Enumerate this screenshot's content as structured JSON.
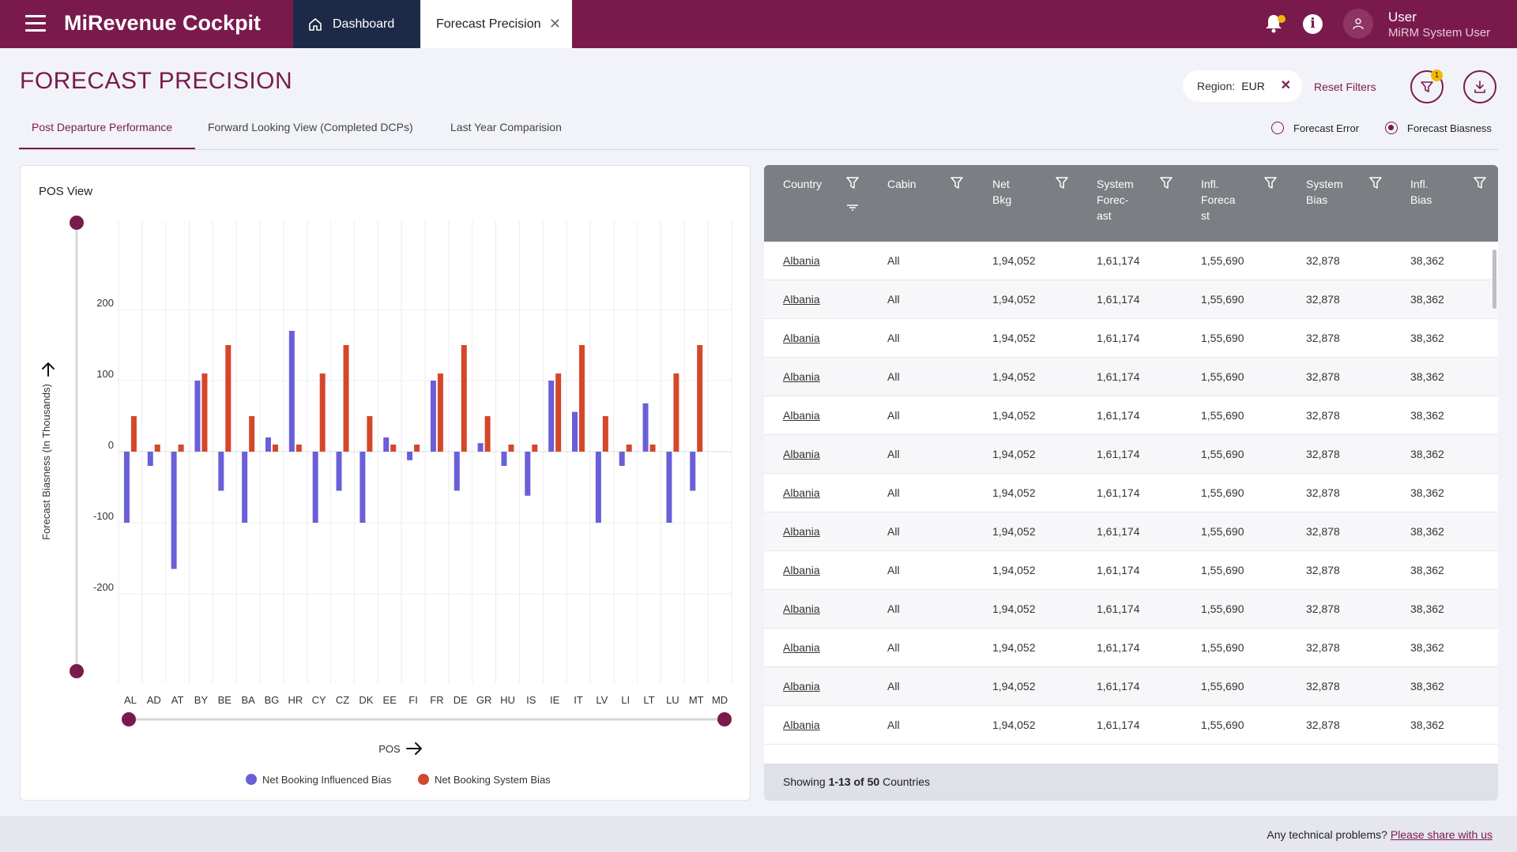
{
  "app": {
    "title": "MiRevenue Cockpit"
  },
  "nav": {
    "dashboard_label": "Dashboard",
    "active_tab_label": "Forecast Precision"
  },
  "user": {
    "name": "User",
    "role": "MiRM System User"
  },
  "page": {
    "title": "FORECAST PRECISION"
  },
  "filters": {
    "region_label": "Region:",
    "region_value": "EUR",
    "reset_label": "Reset Filters",
    "filter_count": "1"
  },
  "subtabs": [
    {
      "label": "Post Departure Performance",
      "active": true
    },
    {
      "label": "Forward Looking View (Completed DCPs)",
      "active": false
    },
    {
      "label": "Last Year Comparision",
      "active": false
    }
  ],
  "view_mode": {
    "options": [
      "Forecast Error",
      "Forecast Biasness"
    ],
    "selected": "Forecast Biasness"
  },
  "chart_title": "POS View",
  "chart_data": {
    "type": "bar",
    "title": "",
    "xlabel": "POS",
    "ylabel": "Forecast Biasness (In Thousands)",
    "ylim": [
      -300,
      300
    ],
    "yticks": [
      200,
      100,
      0,
      -100,
      -200
    ],
    "grid": true,
    "legend_position": "bottom",
    "categories": [
      "AL",
      "AD",
      "AT",
      "BY",
      "BE",
      "BA",
      "BG",
      "HR",
      "CY",
      "CZ",
      "DK",
      "EE",
      "FI",
      "FR",
      "DE",
      "GR",
      "HU",
      "IS",
      "IE",
      "IT",
      "LV",
      "LI",
      "LT",
      "LU",
      "MT",
      "MD"
    ],
    "series": [
      {
        "name": "Net Booking Influenced Bias",
        "color": "#6a5fd8",
        "values": [
          -100,
          -20,
          -165,
          100,
          -55,
          -100,
          20,
          170,
          -100,
          -55,
          -100,
          20,
          -12,
          100,
          -55,
          12,
          -20,
          -62,
          100,
          56,
          -100,
          -20,
          68,
          -100,
          -55,
          0
        ]
      },
      {
        "name": "Net Booking System Bias",
        "color": "#d4472a",
        "values": [
          50,
          10,
          10,
          110,
          150,
          50,
          10,
          10,
          110,
          150,
          50,
          10,
          10,
          110,
          150,
          50,
          10,
          10,
          110,
          150,
          50,
          10,
          10,
          110,
          150,
          0
        ]
      }
    ]
  },
  "table": {
    "columns": [
      {
        "label": "Country"
      },
      {
        "label": "Cabin"
      },
      {
        "label": "Net Bkg"
      },
      {
        "label": "System Forec-ast"
      },
      {
        "label": "Infl. Foreca st"
      },
      {
        "label": "System Bias"
      },
      {
        "label": "Infl. Bias"
      }
    ],
    "column_lines": [
      [
        "Country"
      ],
      [
        "Cabin"
      ],
      [
        "Net",
        "Bkg"
      ],
      [
        "System",
        "Forec-",
        "ast"
      ],
      [
        "Infl.",
        "Foreca",
        "st"
      ],
      [
        "System",
        "Bias"
      ],
      [
        "Infl.",
        "Bias"
      ]
    ],
    "rows": [
      [
        "Albania",
        "All",
        "1,94,052",
        "1,61,174",
        "1,55,690",
        "32,878",
        "38,362"
      ],
      [
        "Albania",
        "All",
        "1,94,052",
        "1,61,174",
        "1,55,690",
        "32,878",
        "38,362"
      ],
      [
        "Albania",
        "All",
        "1,94,052",
        "1,61,174",
        "1,55,690",
        "32,878",
        "38,362"
      ],
      [
        "Albania",
        "All",
        "1,94,052",
        "1,61,174",
        "1,55,690",
        "32,878",
        "38,362"
      ],
      [
        "Albania",
        "All",
        "1,94,052",
        "1,61,174",
        "1,55,690",
        "32,878",
        "38,362"
      ],
      [
        "Albania",
        "All",
        "1,94,052",
        "1,61,174",
        "1,55,690",
        "32,878",
        "38,362"
      ],
      [
        "Albania",
        "All",
        "1,94,052",
        "1,61,174",
        "1,55,690",
        "32,878",
        "38,362"
      ],
      [
        "Albania",
        "All",
        "1,94,052",
        "1,61,174",
        "1,55,690",
        "32,878",
        "38,362"
      ],
      [
        "Albania",
        "All",
        "1,94,052",
        "1,61,174",
        "1,55,690",
        "32,878",
        "38,362"
      ],
      [
        "Albania",
        "All",
        "1,94,052",
        "1,61,174",
        "1,55,690",
        "32,878",
        "38,362"
      ],
      [
        "Albania",
        "All",
        "1,94,052",
        "1,61,174",
        "1,55,690",
        "32,878",
        "38,362"
      ],
      [
        "Albania",
        "All",
        "1,94,052",
        "1,61,174",
        "1,55,690",
        "32,878",
        "38,362"
      ],
      [
        "Albania",
        "All",
        "1,94,052",
        "1,61,174",
        "1,55,690",
        "32,878",
        "38,362"
      ]
    ],
    "footer": {
      "prefix": "Showing ",
      "range": "1-13 of 50",
      "suffix": " Countries"
    }
  },
  "footer": {
    "question": "Any technical problems? ",
    "link": "Please share with us "
  },
  "colors": {
    "brand": "#7a1a4c",
    "nav_dark": "#1d2a47",
    "influenced": "#6a5fd8",
    "system": "#d4472a",
    "header_gray": "#7b7e83"
  }
}
